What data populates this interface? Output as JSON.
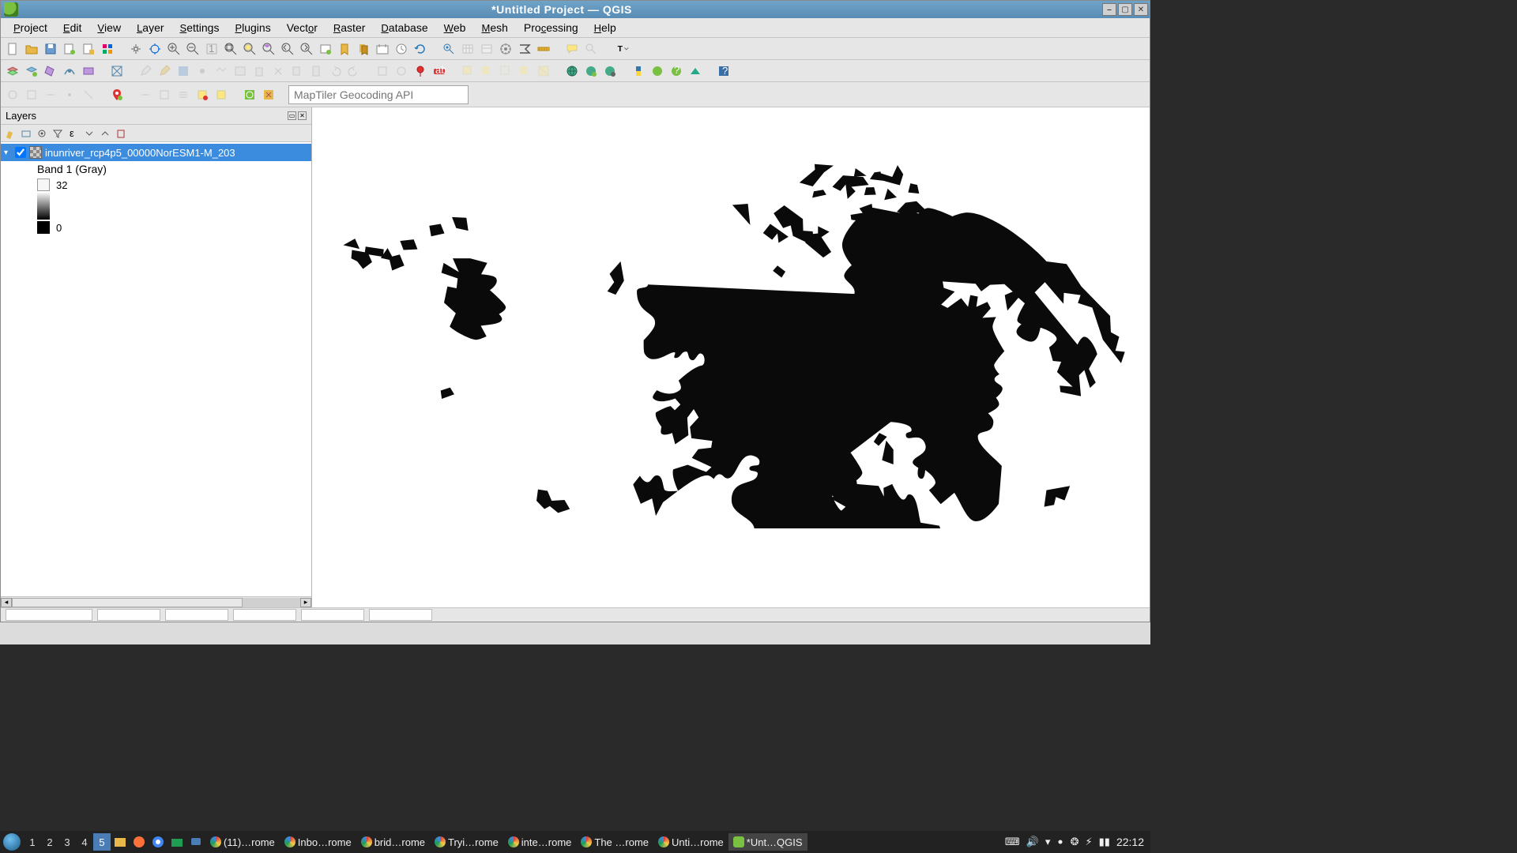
{
  "window": {
    "title": "*Untitled Project — QGIS"
  },
  "menubar": {
    "items": [
      {
        "label": "Project",
        "accel": "P"
      },
      {
        "label": "Edit",
        "accel": "E"
      },
      {
        "label": "View",
        "accel": "V"
      },
      {
        "label": "Layer",
        "accel": "L"
      },
      {
        "label": "Settings",
        "accel": "S"
      },
      {
        "label": "Plugins",
        "accel": "P"
      },
      {
        "label": "Vector",
        "accel": "V"
      },
      {
        "label": "Raster",
        "accel": "R"
      },
      {
        "label": "Database",
        "accel": "D"
      },
      {
        "label": "Web",
        "accel": "W"
      },
      {
        "label": "Mesh",
        "accel": "M"
      },
      {
        "label": "Processing",
        "accel": "P"
      },
      {
        "label": "Help",
        "accel": "H"
      }
    ]
  },
  "search": {
    "placeholder": "MapTiler Geocoding API"
  },
  "layers_panel": {
    "title": "Layers",
    "layer": {
      "name": "inunriver_rcp4p5_00000NorESM1-M_203",
      "checked": true,
      "band_label": "Band 1 (Gray)",
      "legend_max": "32",
      "legend_min": "0"
    }
  },
  "taskbar": {
    "workspaces": [
      "1",
      "2",
      "3",
      "4",
      "5"
    ],
    "active_ws": "5",
    "entries": [
      {
        "label": "(11)…rome",
        "color": "#f7c948"
      },
      {
        "label": "Inbo…rome",
        "color": "#d83b3b"
      },
      {
        "label": "brid…rome",
        "color": "#d83b3b"
      },
      {
        "label": "Tryi…rome",
        "color": "#d83b3b"
      },
      {
        "label": "inte…rome",
        "color": "#1f9d55"
      },
      {
        "label": "The …rome",
        "color": "#d83b3b"
      },
      {
        "label": "Unti…rome",
        "color": "#f7c948"
      },
      {
        "label": "*Unt…QGIS",
        "color": "#7ac142",
        "active": true
      }
    ],
    "clock": "22:12"
  }
}
